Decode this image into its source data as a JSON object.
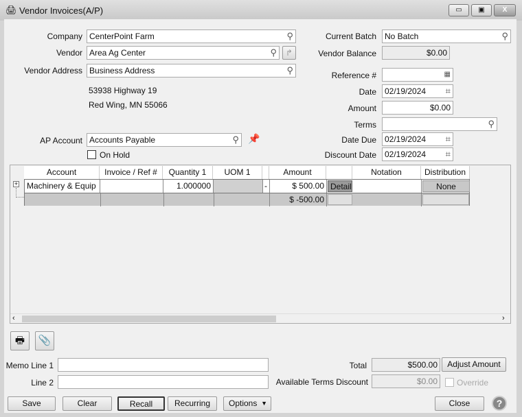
{
  "window": {
    "title": "Vendor Invoices(A/P)",
    "minimize": "▭",
    "maximize": "▣",
    "close": "X"
  },
  "form": {
    "company_label": "Company",
    "company": "CenterPoint Farm",
    "vendor_label": "Vendor",
    "vendor": "Area Ag Center",
    "vendor_address_label": "Vendor Address",
    "vendor_address": "Business Address",
    "address_line1": "53938 Highway 19",
    "address_line2": "Red Wing, MN  55066",
    "ap_account_label": "AP Account",
    "ap_account": "Accounts Payable",
    "on_hold_label": "On Hold",
    "current_batch_label": "Current Batch",
    "current_batch": "No Batch",
    "vendor_balance_label": "Vendor Balance",
    "vendor_balance": "$0.00",
    "reference_label": "Reference #",
    "reference": "",
    "date_label": "Date",
    "date": "02/19/2024",
    "amount_label": "Amount",
    "amount": "$0.00",
    "terms_label": "Terms",
    "terms": "",
    "date_due_label": "Date Due",
    "date_due": "02/19/2024",
    "discount_date_label": "Discount Date",
    "discount_date": "02/19/2024"
  },
  "grid": {
    "columns": [
      "Account",
      "Invoice / Ref #",
      "Quantity 1",
      "UOM 1",
      "",
      "Amount",
      "",
      "Notation",
      "Distribution"
    ],
    "rows": [
      {
        "account": "Machinery & Equip",
        "invoice": "",
        "quantity": "1.000000",
        "uom": "",
        "dash": "-",
        "amount": "$ 500.00",
        "detail": "Detail",
        "notation": "",
        "distribution": "None"
      }
    ],
    "total_row": {
      "amount": "$ -500.00"
    }
  },
  "footer": {
    "memo1_label": "Memo Line 1",
    "memo1": "",
    "memo2_label": "Line 2",
    "memo2": "",
    "total_label": "Total",
    "total": "$500.00",
    "adjust_amount": "Adjust Amount",
    "terms_discount_label": "Available Terms Discount",
    "terms_discount": "$0.00",
    "override_label": "Override"
  },
  "buttons": {
    "save": "Save",
    "clear": "Clear",
    "recall": "Recall",
    "recurring": "Recurring",
    "options": "Options",
    "close": "Close",
    "help": "?"
  }
}
